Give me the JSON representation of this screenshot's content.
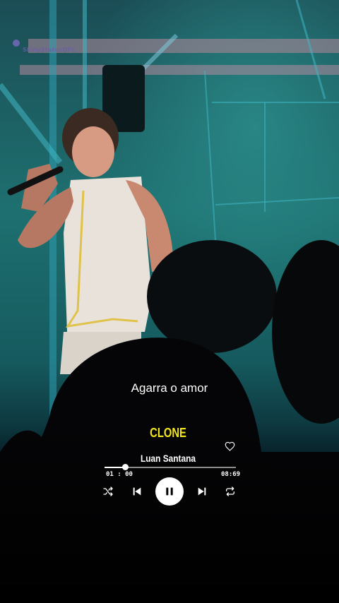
{
  "video": {
    "watermark": "SkinyStatusOFC",
    "lyric": "Agarra o amor"
  },
  "player": {
    "title": "CLONE",
    "artist": "Luan Santana",
    "time_current": "01 : 00",
    "time_total": "08:69",
    "progress_fraction": 0.155,
    "liked": false,
    "icons": {
      "like": "heart-outline-icon",
      "shuffle": "shuffle-icon",
      "previous": "skip-previous-icon",
      "play_pause": "pause-icon",
      "next": "skip-next-icon",
      "repeat": "repeat-icon"
    }
  },
  "colors": {
    "title": "#f2e51e",
    "text": "#ffffff",
    "stage_teal": "#1f7a7a",
    "background": "#000000"
  }
}
